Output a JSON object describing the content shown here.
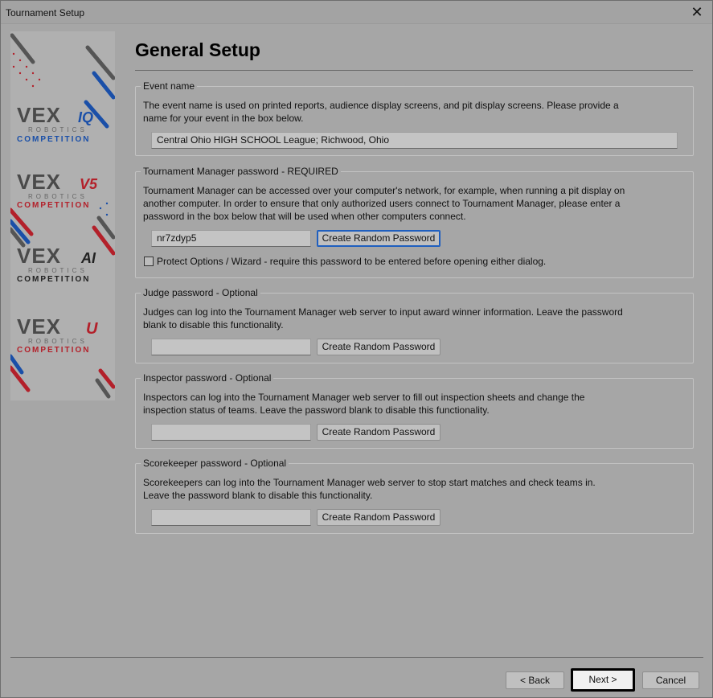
{
  "window": {
    "title": "Tournament Setup",
    "close_glyph": "✕"
  },
  "banner": {
    "logos": [
      {
        "brand": "VEX",
        "suffix": "IQ",
        "line1": "ROBOTICS",
        "line2": "COMPETITION",
        "accent": "#1a4fa8"
      },
      {
        "brand": "VEX",
        "suffix": "V5",
        "line1": "ROBOTICS",
        "line2": "COMPETITION",
        "accent": "#b3202a"
      },
      {
        "brand": "VEX",
        "suffix": "AI",
        "line1": "ROBOTICS",
        "line2": "COMPETITION",
        "accent": "#222222"
      },
      {
        "brand": "VEX",
        "suffix": "U",
        "line1": "ROBOTICS",
        "line2": "COMPETITION",
        "accent": "#b3202a"
      }
    ]
  },
  "page": {
    "title": "General Setup"
  },
  "event": {
    "legend": "Event name",
    "description": "The event name is used on printed reports, audience display screens, and pit display screens.  Please provide a name for your event in the box below.",
    "value": "Central Ohio HIGH SCHOOL League; Richwood, Ohio"
  },
  "tm_password": {
    "legend": "Tournament Manager password - REQUIRED",
    "description": "Tournament Manager can be accessed over your computer's network, for example, when running a pit display on another computer.  In order to ensure that only authorized users connect to Tournament Manager, please enter a password in the box below that will be used when other computers connect.",
    "value": "nr7zdyp5",
    "button": "Create Random Password",
    "checkbox_label": "Protect Options / Wizard - require this password to be entered before opening either dialog.",
    "checkbox_checked": false
  },
  "judge_password": {
    "legend": "Judge password - Optional",
    "description": "Judges can log into the Tournament Manager web server to input award winner information. Leave the password blank to disable this functionality.",
    "value": "",
    "button": "Create Random Password"
  },
  "inspector_password": {
    "legend": "Inspector password - Optional",
    "description": "Inspectors can log into the Tournament Manager web server to fill out inspection sheets and change the inspection status of teams. Leave the password blank to disable this functionality.",
    "value": "",
    "button": "Create Random Password"
  },
  "scorekeeper_password": {
    "legend": "Scorekeeper password - Optional",
    "description": "Scorekeepers can log into the Tournament Manager web server to stop  start matches and check teams in. Leave the password blank to disable this functionality.",
    "value": "",
    "button": "Create Random Password"
  },
  "footer": {
    "back": "< Back",
    "next": "Next >",
    "cancel": "Cancel"
  }
}
